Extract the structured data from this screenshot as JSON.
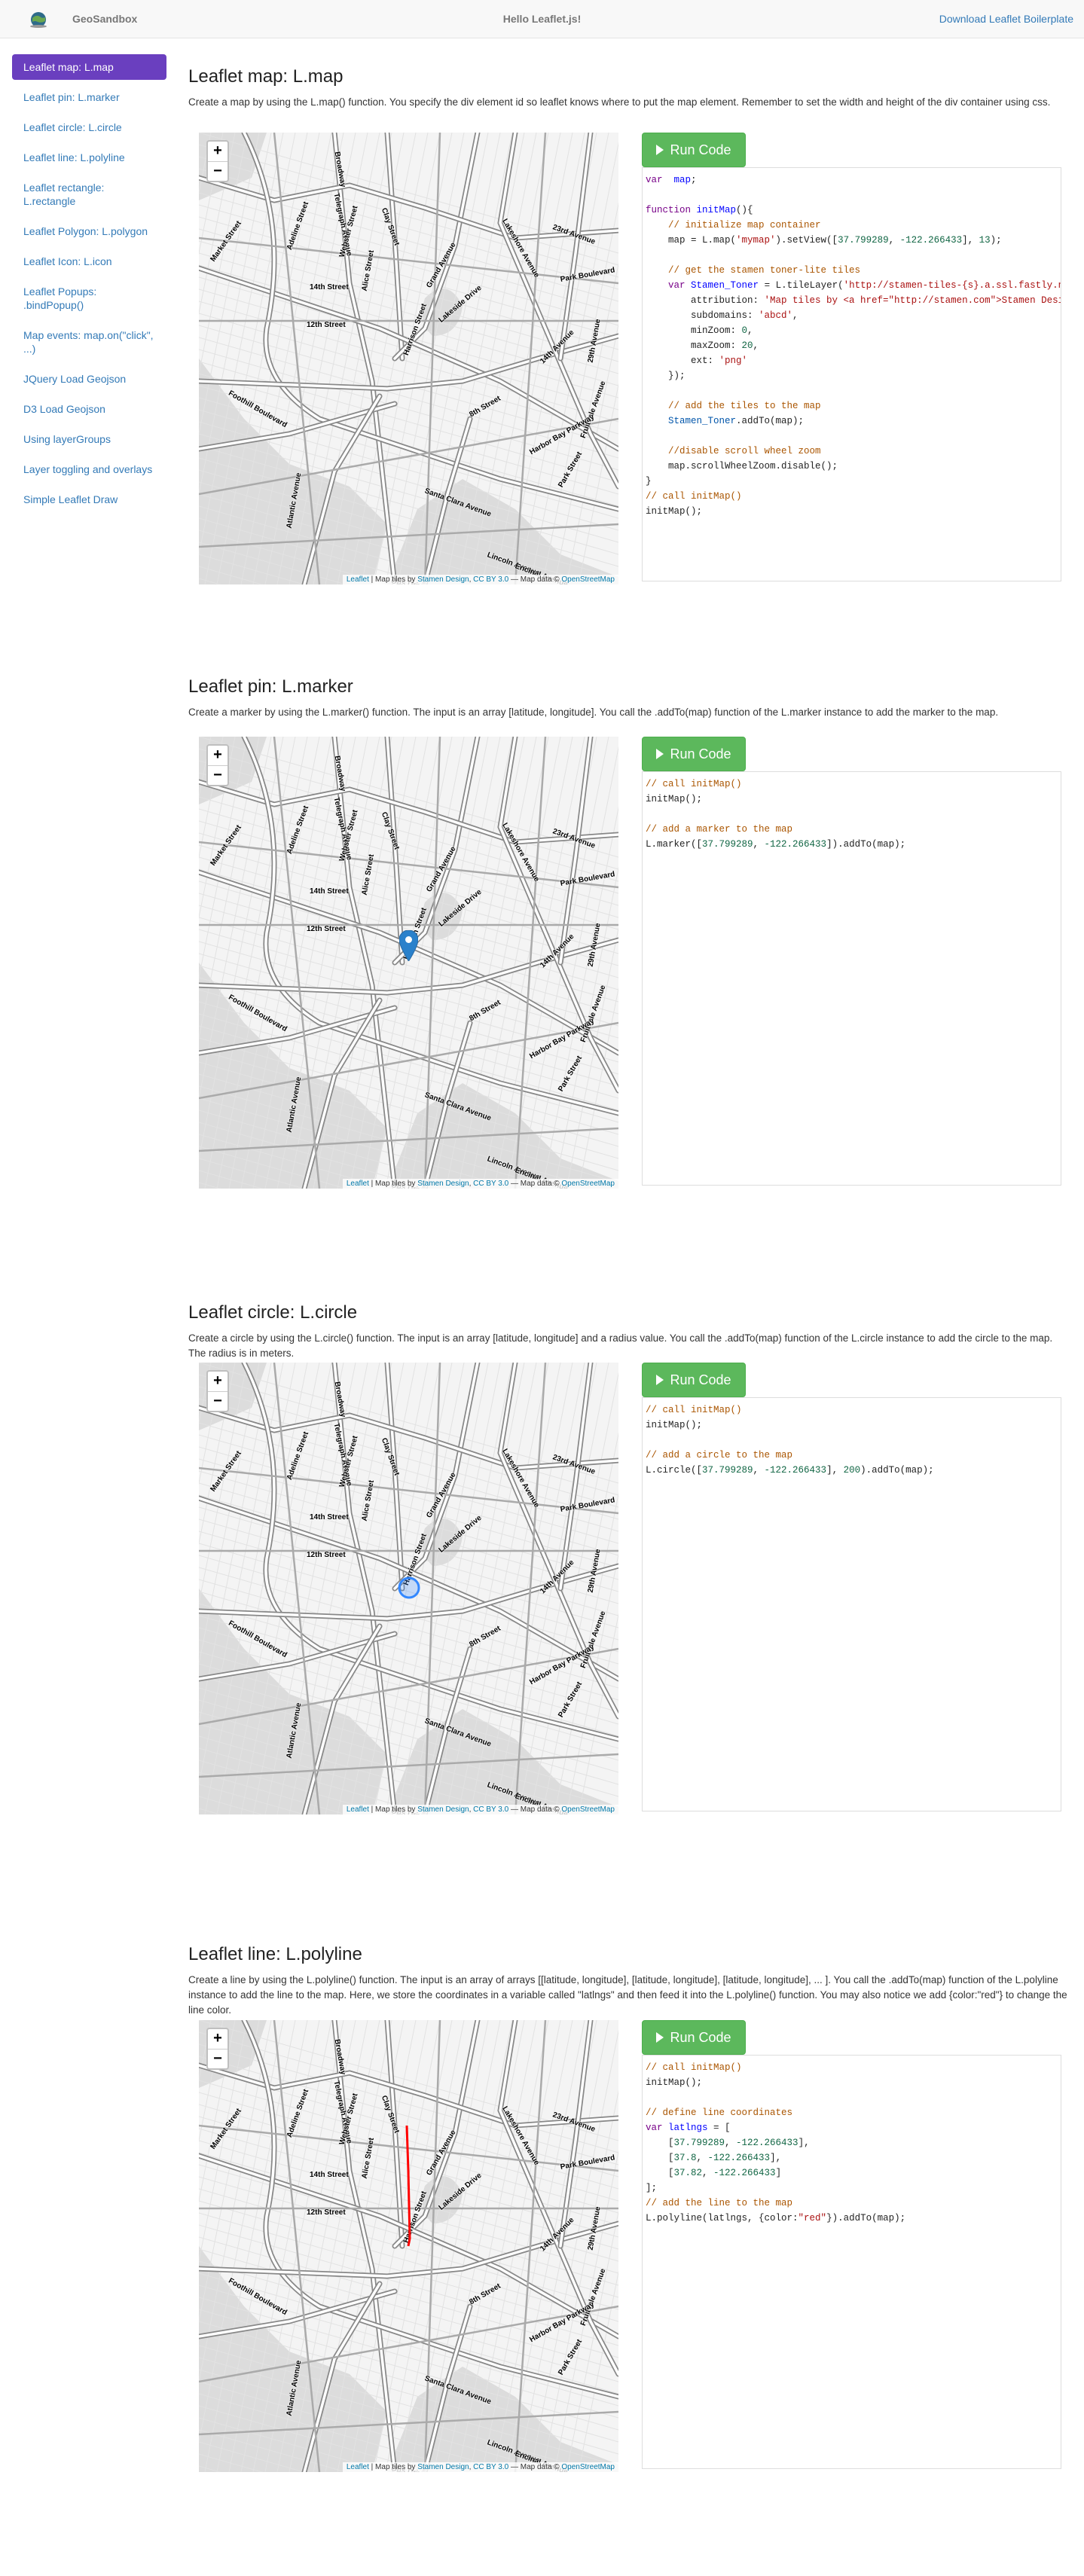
{
  "navbar": {
    "brand": "GeoSandbox",
    "center_title": "Hello Leaflet.js!",
    "download_link": "Download Leaflet Boilerplate"
  },
  "sidebar": {
    "items": [
      {
        "label": "Leaflet map: L.map",
        "active": true
      },
      {
        "label": "Leaflet pin: L.marker"
      },
      {
        "label": "Leaflet circle: L.circle"
      },
      {
        "label": "Leaflet line: L.polyline"
      },
      {
        "label": "Leaflet rectangle: L.rectangle"
      },
      {
        "label": "Leaflet Polygon: L.polygon"
      },
      {
        "label": "Leaflet Icon: L.icon"
      },
      {
        "label": "Leaflet Popups: .bindPopup()"
      },
      {
        "label": "Map events: map.on(\"click\", ...)"
      },
      {
        "label": "JQuery Load Geojson"
      },
      {
        "label": "D3 Load Geojson"
      },
      {
        "label": "Using layerGroups"
      },
      {
        "label": "Layer toggling and overlays"
      },
      {
        "label": "Simple Leaflet Draw"
      }
    ]
  },
  "map_common": {
    "zoom_in": "+",
    "zoom_out": "−",
    "attr_leaflet": "Leaflet",
    "attr_sep1": " | Map tiles by ",
    "attr_stamen": "Stamen Design",
    "attr_comma": ", ",
    "attr_cc": "CC BY 3.0",
    "attr_sep2": " — Map data © ",
    "attr_osm": "OpenStreetMap",
    "run_label": "Run Code"
  },
  "sections": [
    {
      "title": "Leaflet map: L.map",
      "description": "Create a map by using the L.map() function. You specify the div element id so leaflet knows where to put the map element. Remember to set the width and height of the div container using css.",
      "code": [
        [
          [
            "c-kw",
            "var"
          ],
          [
            "",
            "  "
          ],
          [
            "c-def",
            "map"
          ],
          [
            "",
            ";"
          ]
        ],
        [
          [
            "",
            ""
          ]
        ],
        [
          [
            "c-kw",
            "function"
          ],
          [
            "",
            " "
          ],
          [
            "c-def",
            "initMap"
          ],
          [
            "",
            "(){"
          ]
        ],
        [
          [
            "",
            "    "
          ],
          [
            "c-cm",
            "// initialize map container"
          ]
        ],
        [
          [
            "",
            "    map = L.map("
          ],
          [
            "c-str",
            "'mymap'"
          ],
          [
            "",
            ").setView(["
          ],
          [
            "c-num",
            "37.799289"
          ],
          [
            "",
            ", "
          ],
          [
            "c-num",
            "-122.266433"
          ],
          [
            "",
            "], "
          ],
          [
            "c-num",
            "13"
          ],
          [
            "",
            ");"
          ]
        ],
        [
          [
            "",
            ""
          ]
        ],
        [
          [
            "",
            "    "
          ],
          [
            "c-cm",
            "// get the stamen toner-lite tiles"
          ]
        ],
        [
          [
            "",
            "    "
          ],
          [
            "c-kw",
            "var"
          ],
          [
            "",
            " "
          ],
          [
            "c-def",
            "Stamen_Toner"
          ],
          [
            "",
            " = L.tileLayer("
          ],
          [
            "c-str",
            "'http://stamen-tiles-{s}.a.ssl.fastly.net/toner-lite/{z}/{x}/{y}.{ext}'"
          ],
          [
            "",
            ", {"
          ]
        ],
        [
          [
            "",
            "        attribution: "
          ],
          [
            "c-str",
            "'Map tiles by <a href=\"http://stamen.com\">Stamen Design</a>'"
          ],
          [
            "",
            ","
          ]
        ],
        [
          [
            "",
            "        subdomains: "
          ],
          [
            "c-str",
            "'abcd'"
          ],
          [
            "",
            ","
          ]
        ],
        [
          [
            "",
            "        minZoom: "
          ],
          [
            "c-num",
            "0"
          ],
          [
            "",
            ","
          ]
        ],
        [
          [
            "",
            "        maxZoom: "
          ],
          [
            "c-num",
            "20"
          ],
          [
            "",
            ","
          ]
        ],
        [
          [
            "",
            "        ext: "
          ],
          [
            "c-str",
            "'png'"
          ]
        ],
        [
          [
            "",
            "    });"
          ]
        ],
        [
          [
            "",
            ""
          ]
        ],
        [
          [
            "",
            "    "
          ],
          [
            "c-cm",
            "// add the tiles to the map"
          ]
        ],
        [
          [
            "",
            "    "
          ],
          [
            "c-var",
            "Stamen_Toner"
          ],
          [
            "",
            ".addTo(map);"
          ]
        ],
        [
          [
            "",
            ""
          ]
        ],
        [
          [
            "",
            "    "
          ],
          [
            "c-cm",
            "//disable scroll wheel zoom"
          ]
        ],
        [
          [
            "",
            "    map.scrollWheelZoom.disable();"
          ]
        ],
        [
          [
            "",
            "}"
          ]
        ],
        [
          [
            "c-cm",
            "// call initMap()"
          ]
        ],
        [
          [
            "",
            "initMap();"
          ]
        ]
      ]
    },
    {
      "title": "Leaflet pin: L.marker",
      "description": "Create a marker by using the L.marker() function. The input is an array [latitude, longitude]. You call the .addTo(map) function of the L.marker instance to add the marker to the map.",
      "code": [
        [
          [
            "c-cm",
            "// call initMap()"
          ]
        ],
        [
          [
            "",
            "initMap();"
          ]
        ],
        [
          [
            "",
            ""
          ]
        ],
        [
          [
            "c-cm",
            "// add a marker to the map"
          ]
        ],
        [
          [
            "",
            "L.marker(["
          ],
          [
            "c-num",
            "37.799289"
          ],
          [
            "",
            ", "
          ],
          [
            "c-num",
            "-122.266433"
          ],
          [
            "",
            "]).addTo(map);"
          ]
        ]
      ]
    },
    {
      "title": "Leaflet circle: L.circle",
      "description": "Create a circle by using the L.circle() function. The input is an array [latitude, longitude] and a radius value. You call the .addTo(map) function of the L.circle instance to add the circle to the map. The radius is in meters.",
      "code": [
        [
          [
            "c-cm",
            "// call initMap()"
          ]
        ],
        [
          [
            "",
            "initMap();"
          ]
        ],
        [
          [
            "",
            ""
          ]
        ],
        [
          [
            "c-cm",
            "// add a circle to the map"
          ]
        ],
        [
          [
            "",
            "L.circle(["
          ],
          [
            "c-num",
            "37.799289"
          ],
          [
            "",
            ", "
          ],
          [
            "c-num",
            "-122.266433"
          ],
          [
            "",
            "], "
          ],
          [
            "c-num",
            "200"
          ],
          [
            "",
            ").addTo(map);"
          ]
        ]
      ]
    },
    {
      "title": "Leaflet line: L.polyline",
      "description": "Create a line by using the L.polyline() function. The input is an array of arrays [[latitude, longitude], [latitude, longitude], [latitude, longitude], ... ]. You call the .addTo(map) function of the L.polyline instance to add the line to the map. Here, we store the coordinates in a variable called \"latlngs\" and then feed it into the L.polyline() function. You may also notice we add {color:\"red\"} to change the line color.",
      "code": [
        [
          [
            "c-cm",
            "// call initMap()"
          ]
        ],
        [
          [
            "",
            "initMap();"
          ]
        ],
        [
          [
            "",
            ""
          ]
        ],
        [
          [
            "c-cm",
            "// define line coordinates"
          ]
        ],
        [
          [
            "c-kw",
            "var"
          ],
          [
            "",
            " "
          ],
          [
            "c-def",
            "latlngs"
          ],
          [
            "",
            " = ["
          ]
        ],
        [
          [
            "",
            "    ["
          ],
          [
            "c-num",
            "37.799289"
          ],
          [
            "",
            ", "
          ],
          [
            "c-num",
            "-122.266433"
          ],
          [
            "",
            "],"
          ]
        ],
        [
          [
            "",
            "    ["
          ],
          [
            "c-num",
            "37.8"
          ],
          [
            "",
            ", "
          ],
          [
            "c-num",
            "-122.266433"
          ],
          [
            "",
            "],"
          ]
        ],
        [
          [
            "",
            "    ["
          ],
          [
            "c-num",
            "37.82"
          ],
          [
            "",
            ", "
          ],
          [
            "c-num",
            "-122.266433"
          ],
          [
            "",
            "]"
          ]
        ],
        [
          [
            "",
            "];"
          ]
        ],
        [
          [
            "c-cm",
            "// add the line to the map"
          ]
        ],
        [
          [
            "",
            "L.polyline(latlngs, {color:"
          ],
          [
            "c-str",
            "\"red\""
          ],
          [
            "",
            "}).addTo(map);"
          ]
        ]
      ]
    }
  ],
  "map_labels": [
    "Broadway",
    "Telegraph Avenue",
    "14th Street",
    "12th Street",
    "Harrison Street",
    "Grand Avenue",
    "Park Boulevard",
    "14th Avenue",
    "8th Street",
    "Lincoln Avenue",
    "Encinal Avenue",
    "Otis Drive",
    "Market Street",
    "Webster Street",
    "Alice Street",
    "Adeline Street",
    "Lakeshore Avenue",
    "Fruitvale Avenue",
    "Park Street",
    "Clay Street",
    "Lakeside Drive",
    "Santa Clara Avenue",
    "29th Avenue",
    "23rd Avenue",
    "Foothill Boulevard",
    "Harbor Bay Parkway",
    "Atlantic Avenue"
  ],
  "colors": {
    "accent": "#6a3fbf",
    "link": "#337ab7",
    "run_button": "#5cb85c",
    "marker": "#2a81cb",
    "line": "#ff0000"
  }
}
